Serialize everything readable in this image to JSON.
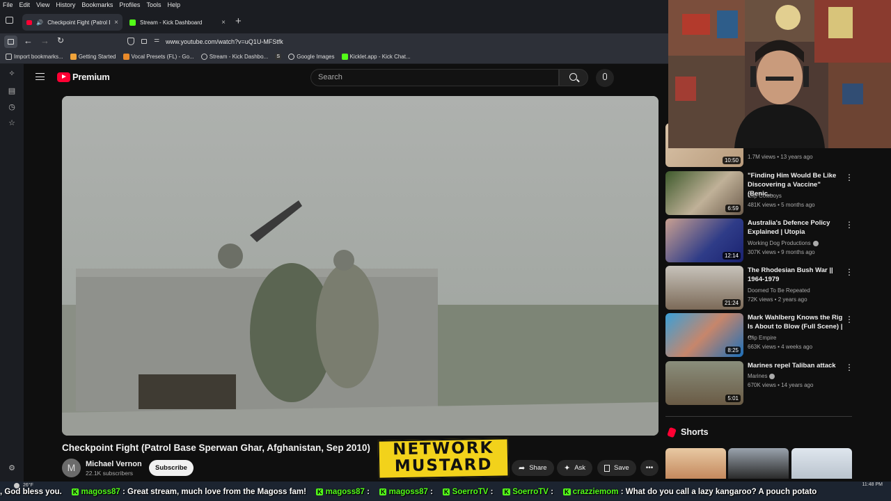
{
  "browser": {
    "menu": [
      "File",
      "Edit",
      "View",
      "History",
      "Bookmarks",
      "Profiles",
      "Tools",
      "Help"
    ],
    "tabs": [
      {
        "label": "Checkpoint Fight (Patrol Ba",
        "active": true
      },
      {
        "label": "Stream - Kick Dashboard",
        "active": false
      }
    ],
    "url": "www.youtube.com/watch?v=uQ1U-MFStfk",
    "bookmarks": [
      "Import bookmarks...",
      "Getting Started",
      "Vocal Presets (FL) - Go...",
      "Stream - Kick Dashbo...",
      "Google Images",
      "Kicklet.app - Kick Chat..."
    ]
  },
  "youtube": {
    "logo_text": "Premium",
    "search_placeholder": "Search",
    "video": {
      "title": "Checkpoint Fight (Patrol Base Sperwan Ghar, Afghanistan, Sep 2010)",
      "channel": "Michael Vernon",
      "avatar_letter": "M",
      "subscribers": "22.1K subscribers",
      "subscribe_label": "Subscribe",
      "share_label": "Share",
      "ask_label": "Ask",
      "save_label": "Save"
    },
    "recommendations": [
      {
        "title": "",
        "channel": "",
        "meta": "1.7M views • 13 years ago",
        "duration": "10:50"
      },
      {
        "title": "\"Finding Him Would Be Like Discovering a Vaccine\" (Benic...",
        "channel": "Clip Cowboys",
        "meta": "481K views • 5 months ago",
        "duration": "6:59"
      },
      {
        "title": "Australia's Defence Policy Explained | Utopia",
        "channel": "Working Dog Productions",
        "verified": true,
        "meta": "307K views • 9 months ago",
        "duration": "12:14"
      },
      {
        "title": "The Rhodesian Bush War || 1964-1979",
        "channel": "Doomed To Be Repeated",
        "meta": "72K views • 2 years ago",
        "duration": "21:24"
      },
      {
        "title": "Mark Wahlberg Knows the Rig Is About to Blow (Full Scene) | ...",
        "channel": "Clip Empire",
        "meta": "663K views • 4 weeks ago",
        "duration": "8:25"
      },
      {
        "title": "Marines repel Taliban attack",
        "channel": "Marines",
        "verified": true,
        "meta": "670K views • 14 years ago",
        "duration": "5:01"
      }
    ],
    "shorts_label": "Shorts"
  },
  "overlay": {
    "logo_line1": "NETWORK",
    "logo_line2": "MUSTARD"
  },
  "ticker": {
    "lead": ", God bless you.",
    "messages": [
      {
        "user": "magoss87",
        "text": ": Great stream, much love from the Magoss fam!"
      },
      {
        "user": "magoss87",
        "text": ":"
      },
      {
        "user": "magoss87",
        "text": ":"
      },
      {
        "user": "SoerroTV",
        "text": ":"
      },
      {
        "user": "SoerroTV",
        "text": ":"
      },
      {
        "user": "crazziemom",
        "text": ": What do you call a lazy kangaroo? A pouch potato"
      }
    ]
  },
  "taskbar": {
    "weather": "26°F",
    "time": "11:48 PM"
  },
  "colors": {
    "accent": "#ff0033",
    "kick_green": "#53fc18",
    "bg": "#0f0f0f"
  }
}
